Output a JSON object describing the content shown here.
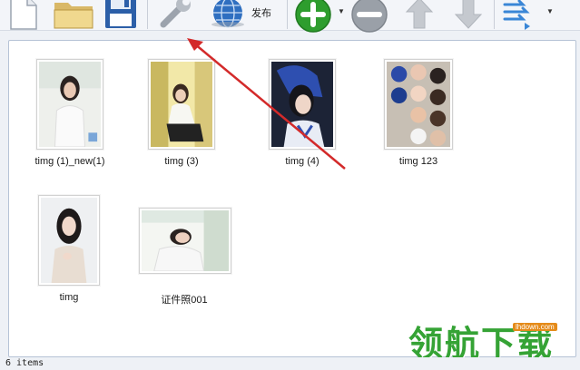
{
  "toolbar": {
    "publish_label": "发布"
  },
  "items": [
    {
      "name": "timg (1)_new(1)"
    },
    {
      "name": "timg (3)"
    },
    {
      "name": "timg (4)"
    },
    {
      "name": "timg 123"
    },
    {
      "name": "timg"
    },
    {
      "name": "证件照001"
    }
  ],
  "status": {
    "text": "6 items"
  },
  "watermark": {
    "text": "领航下载",
    "site": "lhdown.com"
  },
  "colors": {
    "green_button": "#2e9d2e",
    "arrow": "#d32a2a",
    "watermark": "#35a335"
  }
}
